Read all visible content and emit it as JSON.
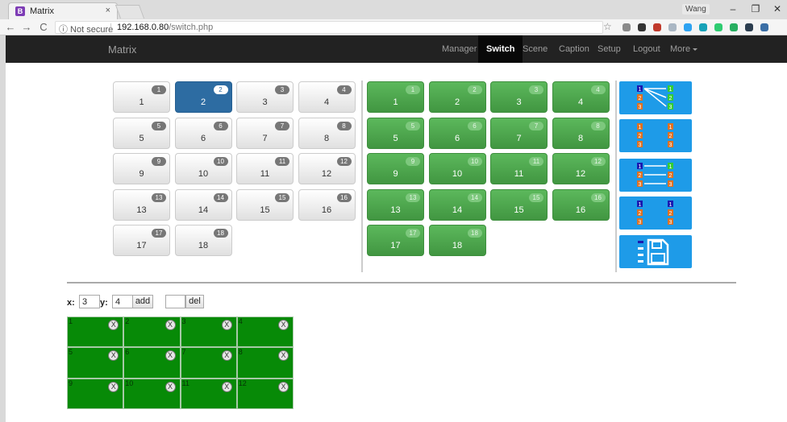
{
  "browser": {
    "tab_title": "Matrix",
    "tab_close": "×",
    "favicon_letter": "B",
    "profile": "Wang",
    "window_controls": [
      "–",
      "❐",
      "✕"
    ],
    "security_label": "ⓘ Not secure",
    "url_host": "192.168.0.80",
    "url_path": "/switch.php",
    "nav": {
      "back": "←",
      "forward": "→",
      "reload": "C"
    },
    "star": "☆",
    "extension_colors": [
      "#8a8a8a",
      "#333333",
      "#c0392b",
      "#aab7c4",
      "#2ea3f2",
      "#17a2b8",
      "#2ecc71",
      "#27ae60",
      "#2c3e50",
      "#3a6ea5"
    ]
  },
  "navbar": {
    "brand": "Matrix",
    "items": [
      "Manager",
      "Switch",
      "Scene",
      "Caption",
      "Setup",
      "Logout",
      "More"
    ],
    "active": "Switch"
  },
  "inputs": {
    "labels": [
      "1",
      "2",
      "3",
      "4",
      "5",
      "6",
      "7",
      "8",
      "9",
      "10",
      "11",
      "12",
      "13",
      "14",
      "15",
      "16",
      "17",
      "18"
    ],
    "selected": "2"
  },
  "outputs": {
    "labels": [
      "1",
      "2",
      "3",
      "4",
      "5",
      "6",
      "7",
      "8",
      "9",
      "10",
      "11",
      "12",
      "13",
      "14",
      "15",
      "16",
      "17",
      "18"
    ]
  },
  "presets": [
    {
      "name": "multi-route",
      "icon": "fanout-icon"
    },
    {
      "name": "all-to-all",
      "icon": "grid-icon"
    },
    {
      "name": "one-to-one",
      "icon": "straight-lines-icon"
    },
    {
      "name": "cleared",
      "icon": "list-icon"
    },
    {
      "name": "save",
      "icon": "save-icon"
    }
  ],
  "layout_editor": {
    "x_label": "x:",
    "x_value": "3",
    "y_label": "y:",
    "y_value": "4",
    "add_label": "add",
    "del_value": "",
    "del_label": "del",
    "rows": 3,
    "cols": 4,
    "cell_numbers": [
      "1",
      "2",
      "3",
      "4",
      "5",
      "6",
      "7",
      "8",
      "9",
      "10",
      "11",
      "12"
    ],
    "close_glyph": "X",
    "grid_color": "#078a07"
  },
  "colors": {
    "input_active": "#2d6ca2",
    "output_green": "#5cb85c",
    "preset_blue": "#1e9be8",
    "navbar": "#222222"
  }
}
